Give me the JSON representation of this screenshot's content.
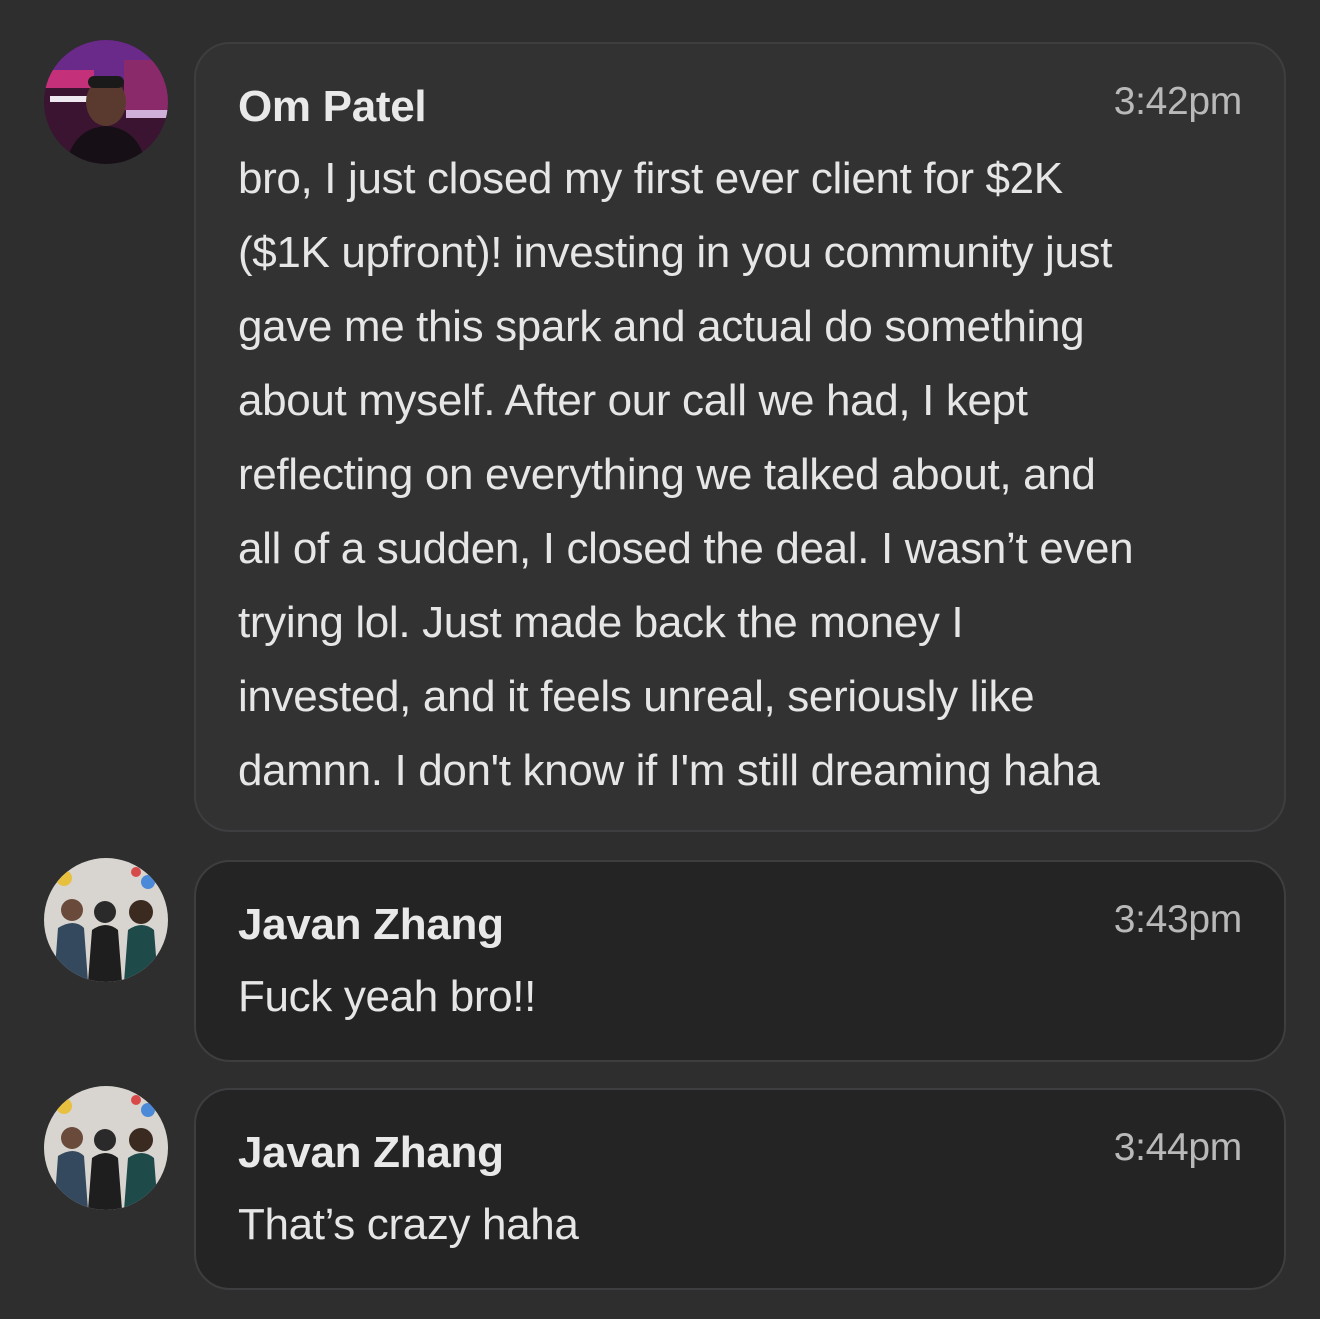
{
  "messages": [
    {
      "author": "Om Patel",
      "time": "3:42pm",
      "text": "bro, I just closed my first ever client for $2K\n($1K upfront)! investing in you community just\ngave me this spark and actual do something\nabout myself. After our call we had, I kept\nreflecting on everything we talked about, and\nall of a sudden, I closed the deal. I wasn’t even\ntrying lol. Just made back the money I\ninvested, and it feels unreal, seriously like\ndamnn. I don't know if I'm still dreaming haha",
      "avatar": "user-photo-om"
    },
    {
      "author": "Javan Zhang",
      "time": "3:43pm",
      "text": "Fuck yeah bro!!",
      "avatar": "group-photo-javan"
    },
    {
      "author": "Javan Zhang",
      "time": "3:44pm",
      "text": "That’s crazy haha",
      "avatar": "group-photo-javan"
    }
  ],
  "colors": {
    "background": "#2e2e2f",
    "bubble_primary": "#323233",
    "bubble_secondary": "#242425",
    "bubble_border": "#3e3e40",
    "text": "#e6e6e6",
    "timestamp": "#b9b9b9"
  }
}
